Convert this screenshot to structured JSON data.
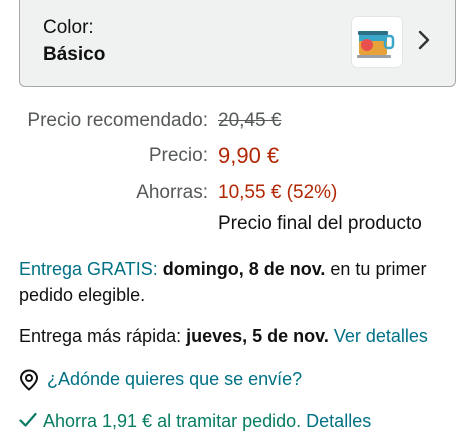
{
  "variant": {
    "label": "Color:",
    "value": "Básico",
    "thumbnail_icon": "product-thumbnail",
    "chevron_icon": "chevron-right-icon"
  },
  "pricing": {
    "recommended_label": "Precio recomendado:",
    "recommended_value": "20,45 €",
    "price_label": "Precio:",
    "price_value": "9,90 €",
    "savings_label": "Ahorras:",
    "savings_value": "10,55 € (52%)",
    "final_note": "Precio final del producto"
  },
  "delivery": {
    "free_prefix": "Entrega GRATIS:",
    "free_date": "domingo, 8 de nov.",
    "free_suffix": " en tu primer",
    "free_line2": "pedido elegible.",
    "fast_prefix": "Entrega más rápida:",
    "fast_date": "jueves, 5 de nov.",
    "fast_link": "Ver detalles",
    "location_icon": "location-pin-icon",
    "location_link": "¿Adónde quieres que se envíe?"
  },
  "promo": {
    "check_icon": "checkmark-icon",
    "text": "Ahorra 1,91 € al tramitar pedido.",
    "link": "Detalles"
  },
  "colors": {
    "price_red": "#b12704",
    "link_teal": "#007185",
    "promo_green": "#067d62",
    "muted_gray": "#565959"
  }
}
